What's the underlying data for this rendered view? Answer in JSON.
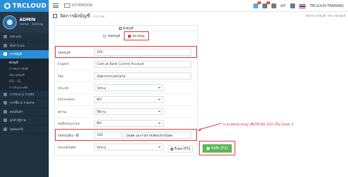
{
  "brand": {
    "name": "TRCLOUD"
  },
  "profile": {
    "name": "ADMIN",
    "sub": "Home : Setting"
  },
  "sidebar": {
    "items": [
      {
        "label": "หน้าแรก"
      },
      {
        "label": "ตั้งค่าระบบ"
      },
      {
        "label": "การบัญชี"
      },
      {
        "label": "ผังบัญชี",
        "sub": true
      },
      {
        "label": "การจัดการบัญชี",
        "sub": true
      },
      {
        "label": "เปิดงวดบัญชี",
        "sub": true
      },
      {
        "label": "GTL - GL",
        "sub": true
      },
      {
        "label": "การเงินและเช็ค",
        "sub": true
      },
      {
        "label": "การขาย & รายรับ"
      },
      {
        "label": "การซื้อ & รายจ่าย"
      },
      {
        "label": "คลังสินค้า"
      },
      {
        "label": "ลูกค้า/ผู้ขาย"
      },
      {
        "label": "บุคคล/HR"
      }
    ]
  },
  "topbar": {
    "extension": "EXTENSION",
    "api": "API",
    "user": "TRCLOUD-TRAINING",
    "badges": [
      "3",
      "1"
    ]
  },
  "page": {
    "title": "จัดการผังบัญชี",
    "subtitle": "ภาษาไทย",
    "crumb_right": "Home / ผังบัญชี / จัดการผังบัญชี"
  },
  "form": {
    "header": "ผังบัญชี",
    "radio": {
      "opt1": "รหัสบัญชี",
      "opt2": "หมวดหมู่"
    },
    "fields": [
      {
        "label": "รหัสบัญชี",
        "value": "102"
      },
      {
        "label": "English",
        "value": "Cash at Bank Current Account"
      },
      {
        "label": "ไทย",
        "value": "เงินฝากกระแสรายวัน"
      },
      {
        "label": "ประเภท",
        "value": "ไม่ระบุ"
      },
      {
        "label": "Eliminated",
        "value": "NO"
      },
      {
        "label": "สถานะ",
        "value": "ใช้งาน"
      },
      {
        "label": "บันทึกกับแถวบน",
        "value": "NO"
      },
      {
        "label": "รหัสบัญชีแม่",
        "value": "100",
        "value2": "เงินสด และรายการเทียบเท่าเงินสด"
      },
      {
        "label": "กระแสเงินสด",
        "value": "ไม่ระบุ"
      }
    ]
  },
  "annotation": "ระบุรหัสหมวดหมู่ เพื่อให้รหัส 102 เป็น Level 2",
  "buttons": {
    "reset": "รีเซต [F5]",
    "save": "บันทึก [F2]"
  },
  "colors": {
    "accent": "#2a8fd6",
    "highlight": "#e23b3b",
    "save": "#5cb85c",
    "sidebar": "#20303f"
  }
}
